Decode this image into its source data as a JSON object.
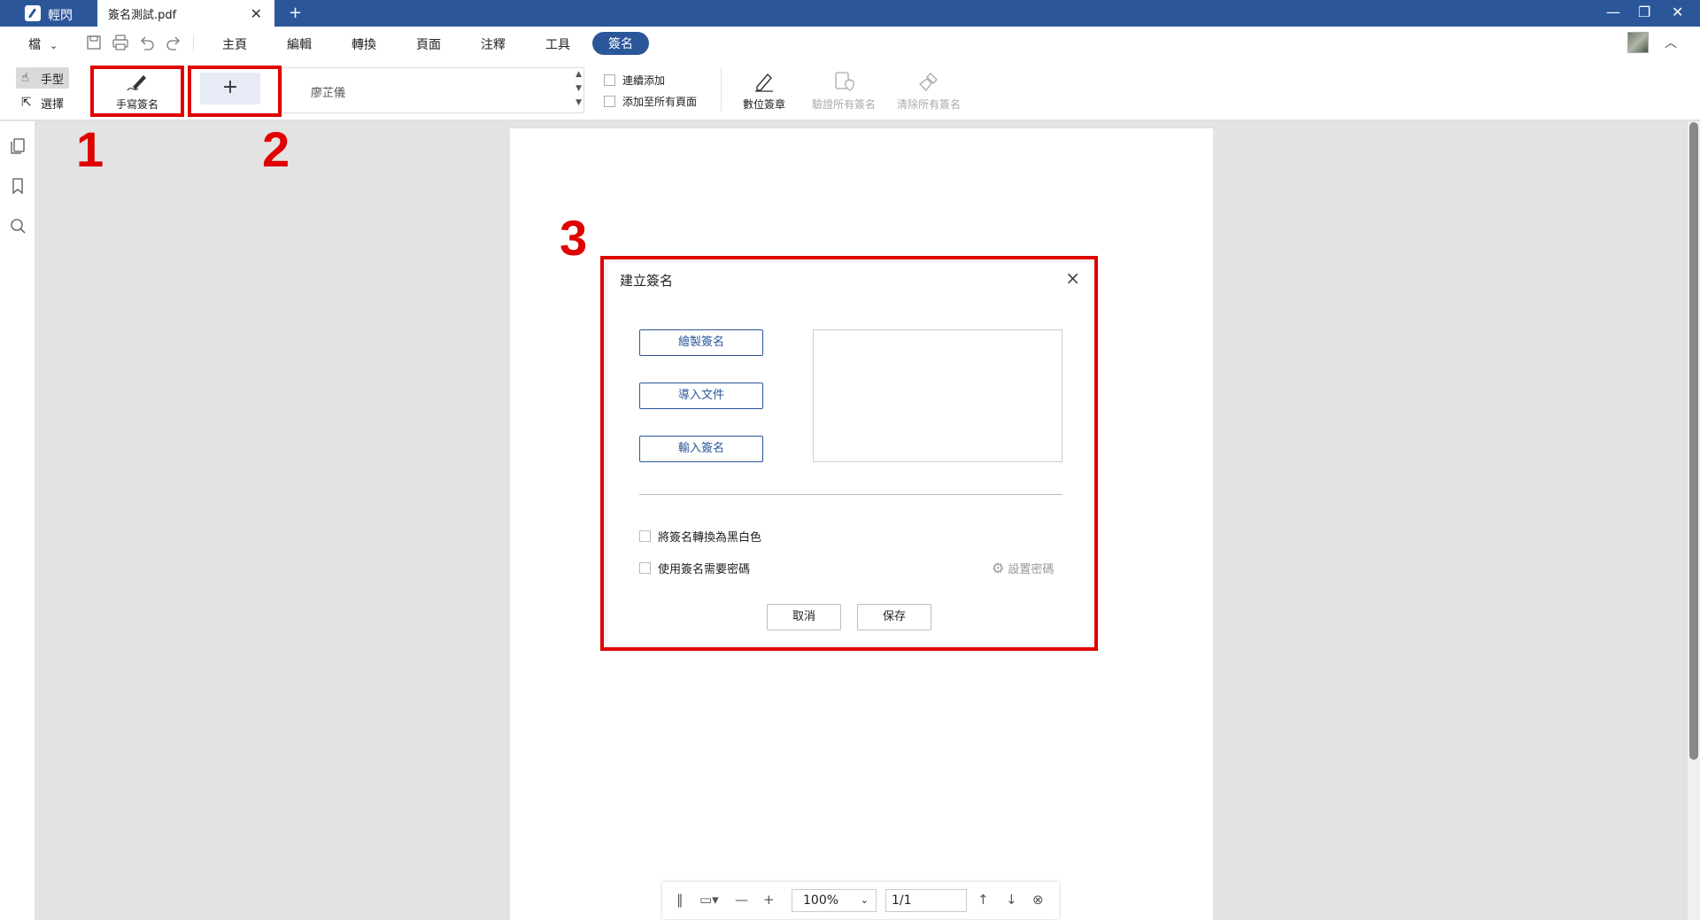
{
  "titlebar": {
    "app_name": "輕閃",
    "doc_tab": "簽名測試.pdf",
    "new_tab": "+",
    "close_tab": "✕",
    "minimize": "—",
    "restore": "❐",
    "close": "✕"
  },
  "menubar": {
    "file": "檔",
    "items": [
      "主頁",
      "編輯",
      "轉換",
      "頁面",
      "注釋",
      "工具",
      "簽名"
    ],
    "active": "簽名"
  },
  "ribbon": {
    "mode_hand": "手型",
    "mode_select": "選擇",
    "handwritten_sign": "手寫簽名",
    "add": "+",
    "saved_signature": "廖芷儀",
    "continuous_add": "連續添加",
    "add_to_all_pages": "添加至所有頁面",
    "digital_stamp": "數位簽章",
    "verify_all": "驗證所有簽名",
    "clear_all": "清除所有簽名"
  },
  "annotations": [
    "1",
    "2",
    "3"
  ],
  "dialog": {
    "title": "建立簽名",
    "draw": "繪製簽名",
    "import": "導入文件",
    "type": "輸入簽名",
    "convert_bw": "將簽名轉換為黑白色",
    "require_password": "使用簽名需要密碼",
    "set_password": "設置密碼",
    "cancel": "取消",
    "save": "保存"
  },
  "bottombar": {
    "zoom": "100%",
    "page": "1/1"
  },
  "colors": {
    "brand": "#2b579a",
    "annotation": "#e00000"
  }
}
